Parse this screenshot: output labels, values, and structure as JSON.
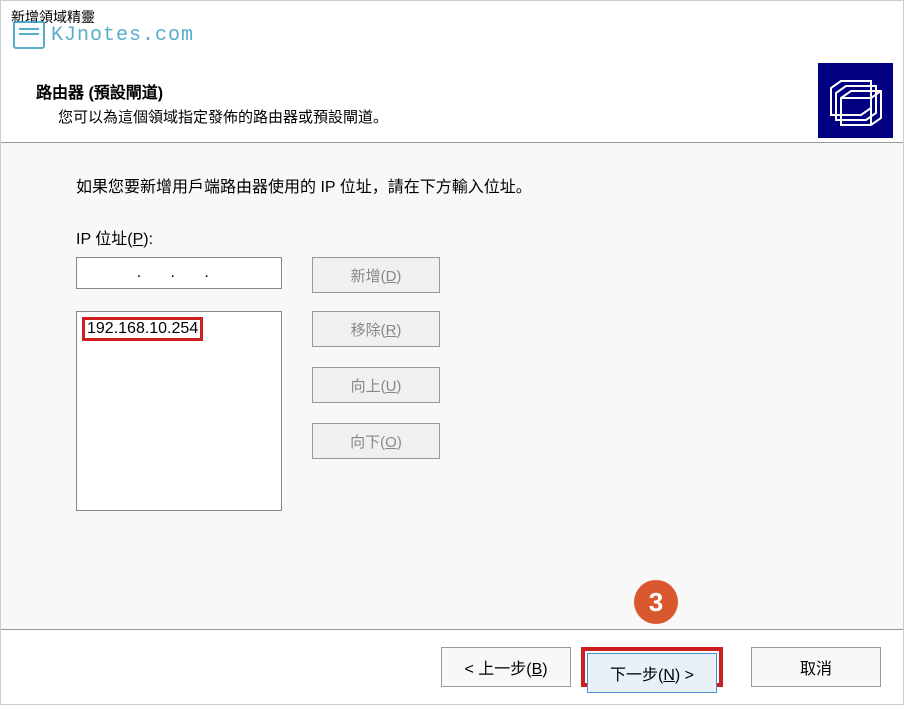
{
  "window": {
    "title": "新增領域精靈"
  },
  "watermark": {
    "text": "KJnotes.com"
  },
  "header": {
    "title": "路由器 (預設閘道)",
    "subtitle": "您可以為這個領域指定發佈的路由器或預設閘道。"
  },
  "content": {
    "instruction": "如果您要新增用戶端路由器使用的 IP 位址，請在下方輸入位址。",
    "ip_label_prefix": "IP 位址(",
    "ip_label_key": "P",
    "ip_label_suffix": "):",
    "ip_input_value": "  .   .   .   ",
    "ip_list": [
      "192.168.10.254"
    ],
    "buttons": {
      "add_prefix": "新增(",
      "add_key": "D",
      "add_suffix": ")",
      "remove_prefix": "移除(",
      "remove_key": "R",
      "remove_suffix": ")",
      "up_prefix": "向上(",
      "up_key": "U",
      "up_suffix": ")",
      "down_prefix": "向下(",
      "down_key": "O",
      "down_suffix": ")"
    }
  },
  "footer": {
    "back_prefix": "< 上一步(",
    "back_key": "B",
    "back_suffix": ")",
    "next_prefix": "下一步(",
    "next_key": "N",
    "next_suffix": ") >",
    "cancel": "取消"
  },
  "annotation": {
    "number": "3"
  }
}
